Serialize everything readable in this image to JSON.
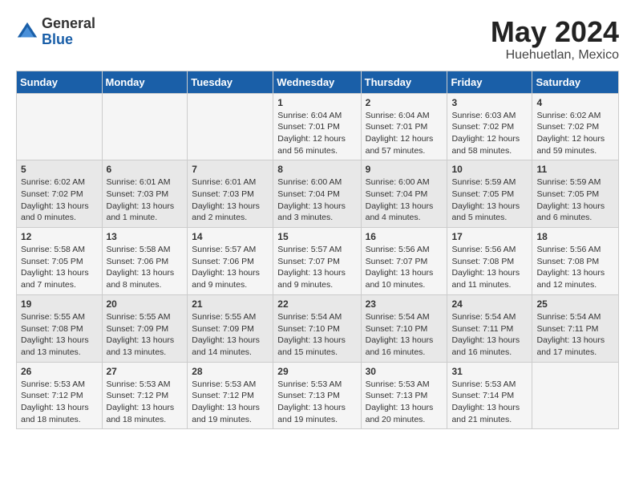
{
  "logo": {
    "general": "General",
    "blue": "Blue"
  },
  "title": {
    "month_year": "May 2024",
    "location": "Huehuetlan, Mexico"
  },
  "weekdays": [
    "Sunday",
    "Monday",
    "Tuesday",
    "Wednesday",
    "Thursday",
    "Friday",
    "Saturday"
  ],
  "weeks": [
    [
      {
        "day": "",
        "info": ""
      },
      {
        "day": "",
        "info": ""
      },
      {
        "day": "",
        "info": ""
      },
      {
        "day": "1",
        "info": "Sunrise: 6:04 AM\nSunset: 7:01 PM\nDaylight: 12 hours\nand 56 minutes."
      },
      {
        "day": "2",
        "info": "Sunrise: 6:04 AM\nSunset: 7:01 PM\nDaylight: 12 hours\nand 57 minutes."
      },
      {
        "day": "3",
        "info": "Sunrise: 6:03 AM\nSunset: 7:02 PM\nDaylight: 12 hours\nand 58 minutes."
      },
      {
        "day": "4",
        "info": "Sunrise: 6:02 AM\nSunset: 7:02 PM\nDaylight: 12 hours\nand 59 minutes."
      }
    ],
    [
      {
        "day": "5",
        "info": "Sunrise: 6:02 AM\nSunset: 7:02 PM\nDaylight: 13 hours\nand 0 minutes."
      },
      {
        "day": "6",
        "info": "Sunrise: 6:01 AM\nSunset: 7:03 PM\nDaylight: 13 hours\nand 1 minute."
      },
      {
        "day": "7",
        "info": "Sunrise: 6:01 AM\nSunset: 7:03 PM\nDaylight: 13 hours\nand 2 minutes."
      },
      {
        "day": "8",
        "info": "Sunrise: 6:00 AM\nSunset: 7:04 PM\nDaylight: 13 hours\nand 3 minutes."
      },
      {
        "day": "9",
        "info": "Sunrise: 6:00 AM\nSunset: 7:04 PM\nDaylight: 13 hours\nand 4 minutes."
      },
      {
        "day": "10",
        "info": "Sunrise: 5:59 AM\nSunset: 7:05 PM\nDaylight: 13 hours\nand 5 minutes."
      },
      {
        "day": "11",
        "info": "Sunrise: 5:59 AM\nSunset: 7:05 PM\nDaylight: 13 hours\nand 6 minutes."
      }
    ],
    [
      {
        "day": "12",
        "info": "Sunrise: 5:58 AM\nSunset: 7:05 PM\nDaylight: 13 hours\nand 7 minutes."
      },
      {
        "day": "13",
        "info": "Sunrise: 5:58 AM\nSunset: 7:06 PM\nDaylight: 13 hours\nand 8 minutes."
      },
      {
        "day": "14",
        "info": "Sunrise: 5:57 AM\nSunset: 7:06 PM\nDaylight: 13 hours\nand 9 minutes."
      },
      {
        "day": "15",
        "info": "Sunrise: 5:57 AM\nSunset: 7:07 PM\nDaylight: 13 hours\nand 9 minutes."
      },
      {
        "day": "16",
        "info": "Sunrise: 5:56 AM\nSunset: 7:07 PM\nDaylight: 13 hours\nand 10 minutes."
      },
      {
        "day": "17",
        "info": "Sunrise: 5:56 AM\nSunset: 7:08 PM\nDaylight: 13 hours\nand 11 minutes."
      },
      {
        "day": "18",
        "info": "Sunrise: 5:56 AM\nSunset: 7:08 PM\nDaylight: 13 hours\nand 12 minutes."
      }
    ],
    [
      {
        "day": "19",
        "info": "Sunrise: 5:55 AM\nSunset: 7:08 PM\nDaylight: 13 hours\nand 13 minutes."
      },
      {
        "day": "20",
        "info": "Sunrise: 5:55 AM\nSunset: 7:09 PM\nDaylight: 13 hours\nand 13 minutes."
      },
      {
        "day": "21",
        "info": "Sunrise: 5:55 AM\nSunset: 7:09 PM\nDaylight: 13 hours\nand 14 minutes."
      },
      {
        "day": "22",
        "info": "Sunrise: 5:54 AM\nSunset: 7:10 PM\nDaylight: 13 hours\nand 15 minutes."
      },
      {
        "day": "23",
        "info": "Sunrise: 5:54 AM\nSunset: 7:10 PM\nDaylight: 13 hours\nand 16 minutes."
      },
      {
        "day": "24",
        "info": "Sunrise: 5:54 AM\nSunset: 7:11 PM\nDaylight: 13 hours\nand 16 minutes."
      },
      {
        "day": "25",
        "info": "Sunrise: 5:54 AM\nSunset: 7:11 PM\nDaylight: 13 hours\nand 17 minutes."
      }
    ],
    [
      {
        "day": "26",
        "info": "Sunrise: 5:53 AM\nSunset: 7:12 PM\nDaylight: 13 hours\nand 18 minutes."
      },
      {
        "day": "27",
        "info": "Sunrise: 5:53 AM\nSunset: 7:12 PM\nDaylight: 13 hours\nand 18 minutes."
      },
      {
        "day": "28",
        "info": "Sunrise: 5:53 AM\nSunset: 7:12 PM\nDaylight: 13 hours\nand 19 minutes."
      },
      {
        "day": "29",
        "info": "Sunrise: 5:53 AM\nSunset: 7:13 PM\nDaylight: 13 hours\nand 19 minutes."
      },
      {
        "day": "30",
        "info": "Sunrise: 5:53 AM\nSunset: 7:13 PM\nDaylight: 13 hours\nand 20 minutes."
      },
      {
        "day": "31",
        "info": "Sunrise: 5:53 AM\nSunset: 7:14 PM\nDaylight: 13 hours\nand 21 minutes."
      },
      {
        "day": "",
        "info": ""
      }
    ]
  ]
}
